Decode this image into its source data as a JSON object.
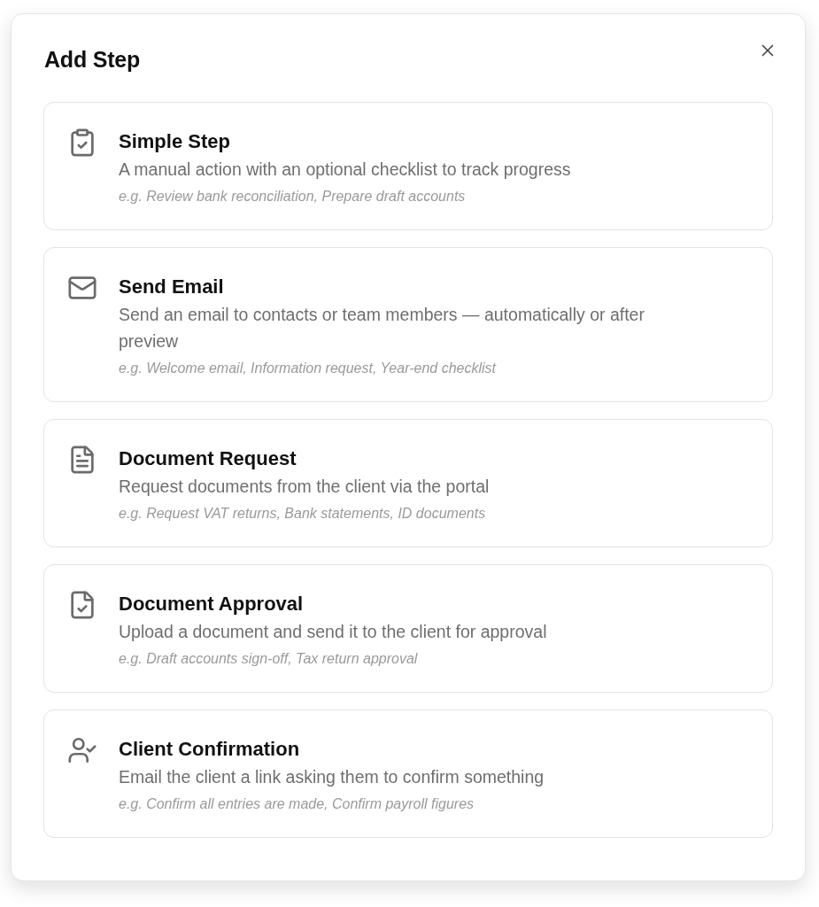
{
  "dialog": {
    "title": "Add Step"
  },
  "step_types": [
    {
      "kind": "checklist",
      "title": "Simple Step",
      "description": "A manual action with an optional checklist to track progress",
      "example": "e.g. Review bank reconciliation, Prepare draft accounts"
    },
    {
      "kind": "email",
      "title": "Send Email",
      "description": "Send an email to contacts or team members — automatically or after preview",
      "example": "e.g. Welcome email, Information request, Year-end checklist"
    },
    {
      "kind": "document",
      "title": "Document Request",
      "description": "Request documents from the client via the portal",
      "example": "e.g. Request VAT returns, Bank statements, ID documents"
    },
    {
      "kind": "approval",
      "title": "Document Approval",
      "description": "Upload a document and send it to the client for approval",
      "example": "e.g. Draft accounts sign-off, Tax return approval"
    },
    {
      "kind": "confirmation",
      "title": "Client Confirmation",
      "description": "Email the client a link asking them to confirm something",
      "example": "e.g. Confirm all entries are made, Confirm payroll figures"
    }
  ]
}
